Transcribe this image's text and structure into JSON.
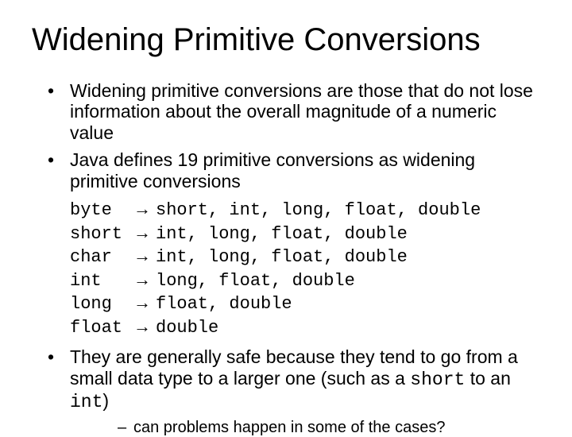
{
  "title": "Widening Primitive Conversions",
  "bullets": {
    "b1": "Widening primitive conversions are those that do not lose information about the overall magnitude of a numeric value",
    "b2": "Java defines 19 primitive conversions as widening primitive conversions",
    "b3_pre": "They are generally safe because they tend to go from a small data type to a larger one (such as a ",
    "b3_code1": "short",
    "b3_mid": " to an ",
    "b3_code2": "int",
    "b3_post": ")",
    "sub1": "can problems happen in some of the cases?"
  },
  "arrow": "→",
  "conversions": [
    {
      "from": "byte",
      "to": "short, int, long, float, double"
    },
    {
      "from": "short",
      "to": "int, long, float, double"
    },
    {
      "from": "char",
      "to": "int, long, float, double"
    },
    {
      "from": "int",
      "to": "long, float, double"
    },
    {
      "from": "long",
      "to": "float, double"
    },
    {
      "from": "float",
      "to": "double"
    }
  ]
}
